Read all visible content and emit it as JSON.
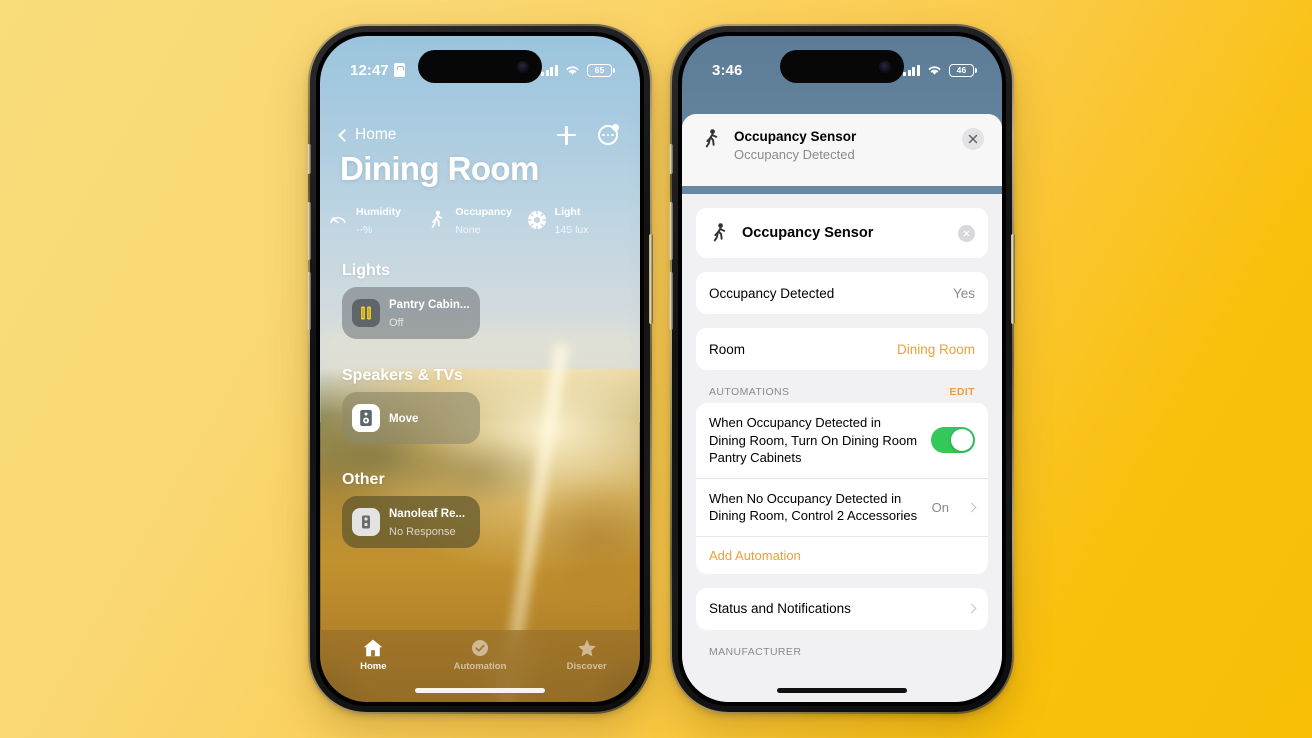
{
  "background": {
    "color_start": "#f9dd7b",
    "color_end": "#f8bf06"
  },
  "left_phone": {
    "status_bar": {
      "time": "12:47",
      "lock_icon": "lock-badge-icon",
      "signal_icon": "cellular-bars-icon",
      "wifi_icon": "wifi-icon",
      "battery": "65"
    },
    "nav": {
      "back_label": "Home",
      "add_label": "add-icon",
      "more_label": "more-options-icon"
    },
    "title": "Dining Room",
    "sensors": [
      {
        "icon": "humidity-icon",
        "name": "Humidity",
        "value": "--%"
      },
      {
        "icon": "occupancy-walk-icon",
        "name": "Occupancy",
        "value": "None"
      },
      {
        "icon": "light-brightness-icon",
        "name": "Light",
        "value": "145 lux"
      }
    ],
    "sections": [
      {
        "heading": "Lights",
        "tile": {
          "icon": "light-strip-icon",
          "name": "Pantry Cabin...",
          "state": "Off"
        }
      },
      {
        "heading": "Speakers & TVs",
        "tile": {
          "icon": "speaker-icon",
          "name": "Move",
          "state": ""
        }
      },
      {
        "heading": "Other",
        "tile": {
          "icon": "nanoleaf-icon",
          "name": "Nanoleaf Re...",
          "state": "No Response"
        }
      }
    ],
    "tabs": [
      {
        "icon": "home-icon",
        "label": "Home",
        "active": true
      },
      {
        "icon": "automation-clock-icon",
        "label": "Automation",
        "active": false
      },
      {
        "icon": "star-icon",
        "label": "Discover",
        "active": false
      }
    ]
  },
  "right_phone": {
    "status_bar": {
      "time": "3:46",
      "signal_icon": "cellular-bars-icon",
      "wifi_icon": "wifi-icon",
      "battery": "46"
    },
    "sheet_header": {
      "icon": "occupancy-walk-icon",
      "title": "Occupancy Sensor",
      "subtitle": "Occupancy Detected",
      "close_icon": "close-icon"
    },
    "title_card": {
      "icon": "occupancy-walk-icon",
      "name": "Occupancy Sensor",
      "clear_icon": "clear-icon"
    },
    "detail_rows": [
      {
        "label": "Occupancy Detected",
        "value": "Yes",
        "accent": false
      },
      {
        "label": "Room",
        "value": "Dining Room",
        "accent": true
      }
    ],
    "automations": {
      "group_title": "AUTOMATIONS",
      "group_action": "EDIT",
      "items": [
        {
          "text": "When Occupancy Detected in Dining Room, Turn On Dining Room Pantry Cabinets",
          "control": "toggle",
          "state": "on"
        },
        {
          "text": "When No Occupancy Detected in Dining Room, Control 2 Accessories",
          "control": "disclosure",
          "state": "On"
        }
      ],
      "add_link": "Add Automation"
    },
    "status_row": {
      "label": "Status and Notifications"
    },
    "manufacturer_header": "MANUFACTURER"
  },
  "colors": {
    "accent_orange": "#e8a13a",
    "toggle_green": "#34c759"
  }
}
